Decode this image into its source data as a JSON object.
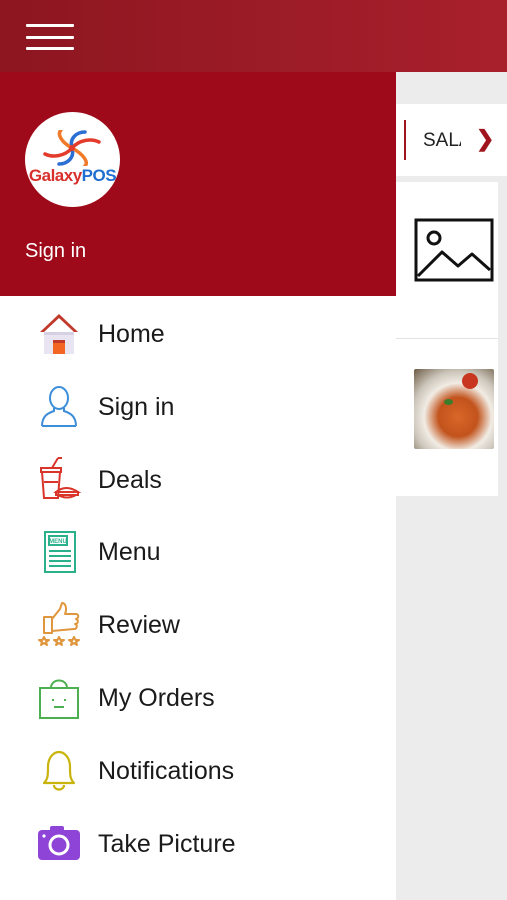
{
  "topbar": {
    "menu_icon": "hamburger-menu-icon"
  },
  "background": {
    "category_label": "SALA",
    "category_chevron": "chevron-right-icon",
    "items": [
      {
        "image": "image-placeholder-icon"
      },
      {
        "image": "pasta-dish-photo"
      }
    ]
  },
  "drawer": {
    "logo": {
      "text_part1": "Galaxy",
      "text_part2": "POS"
    },
    "header_signin": "Sign in",
    "items": [
      {
        "label": "Home",
        "icon": "home-icon"
      },
      {
        "label": "Sign in",
        "icon": "user-icon"
      },
      {
        "label": "Deals",
        "icon": "deals-food-icon"
      },
      {
        "label": "Menu",
        "icon": "menu-card-icon"
      },
      {
        "label": "Review",
        "icon": "thumbs-up-stars-icon"
      },
      {
        "label": "My Orders",
        "icon": "shopping-bag-icon"
      },
      {
        "label": "Notifications",
        "icon": "bell-icon"
      },
      {
        "label": "Take Picture",
        "icon": "camera-icon"
      }
    ]
  },
  "colors": {
    "topbar": "#9a1b25",
    "drawer_header": "#9e0a19",
    "accent": "#a0141e",
    "content_bg": "#ececec"
  }
}
